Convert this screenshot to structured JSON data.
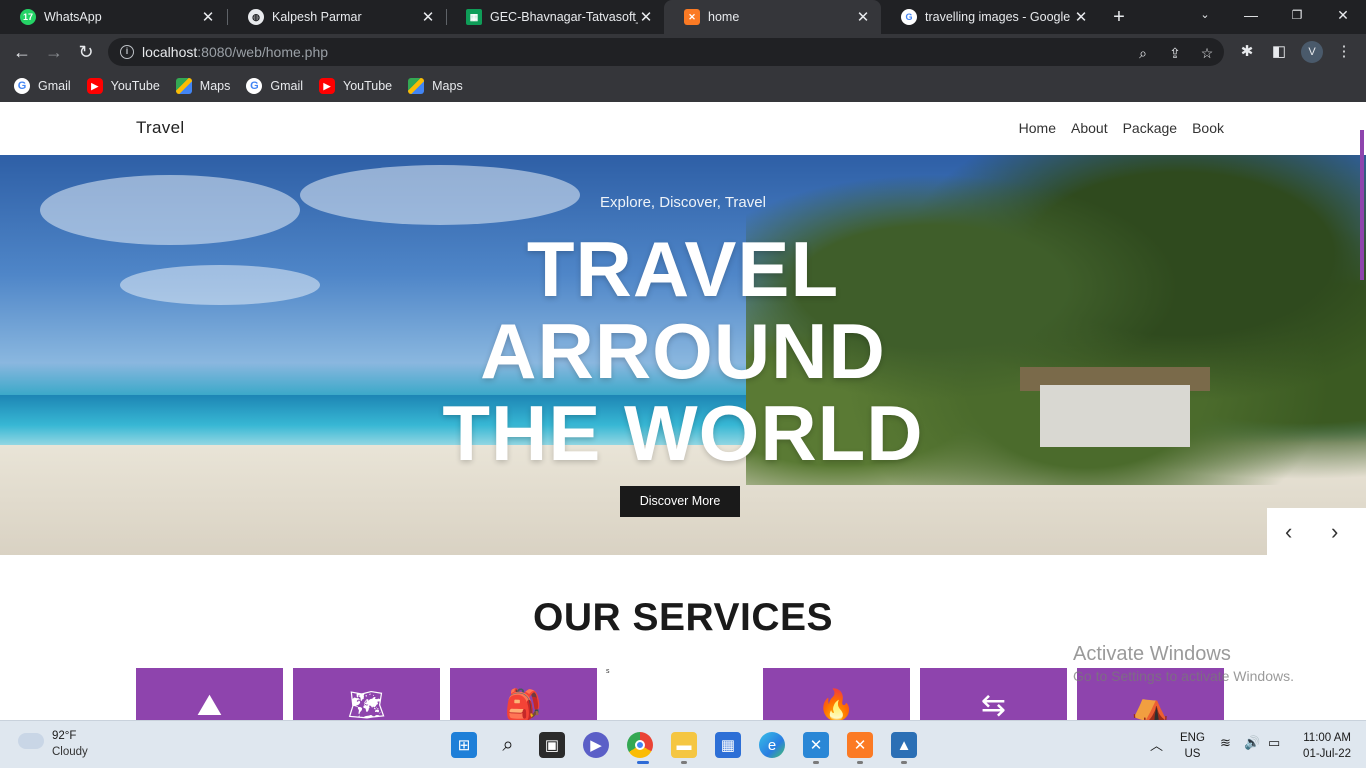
{
  "browser": {
    "tabs": [
      {
        "label": "WhatsApp",
        "icon": "whatsapp-icon",
        "badge": "17",
        "color": "#25d366"
      },
      {
        "label": "Kalpesh Parmar",
        "icon": "globe-icon",
        "color": "#e8eaed"
      },
      {
        "label": "GEC-Bhavnagar-Tatvasoft_Int",
        "icon": "sheets-icon",
        "color": "#0f9d58"
      },
      {
        "label": "home",
        "icon": "xampp-icon",
        "color": "#fb7a24",
        "active": true
      },
      {
        "label": "travelling images - Google Se",
        "icon": "google-icon",
        "color": "#ffffff"
      }
    ],
    "url_host": "localhost",
    "url_rest": ":8080/web/home.php",
    "profile_initial": "V",
    "bookmarks": [
      {
        "label": "Gmail",
        "icon": "google-icon",
        "glyph": "G"
      },
      {
        "label": "YouTube",
        "icon": "youtube-icon",
        "glyph": "▶"
      },
      {
        "label": "Maps",
        "icon": "maps-icon",
        "glyph": ""
      },
      {
        "label": "Gmail",
        "icon": "google-icon",
        "glyph": "G"
      },
      {
        "label": "YouTube",
        "icon": "youtube-icon",
        "glyph": "▶"
      },
      {
        "label": "Maps",
        "icon": "maps-icon",
        "glyph": ""
      }
    ]
  },
  "site": {
    "brand": "Travel",
    "menu": [
      "Home",
      "About",
      "Package",
      "Book"
    ],
    "hero": {
      "subtitle": "Explore, Discover, Travel",
      "title_lines": [
        "TRAVEL",
        "ARROUND",
        "THE WORLD"
      ],
      "button": "Discover More"
    },
    "services_title": "OUR SERVICES",
    "stray_char": "s",
    "accent": "#8e44ad"
  },
  "watermark": {
    "line1": "Activate Windows",
    "line2": "Go to Settings to activate Windows."
  },
  "taskbar": {
    "temperature": "92°F",
    "condition": "Cloudy",
    "language": "ENG",
    "region": "US",
    "time": "11:00 AM",
    "date": "01-Jul-22"
  }
}
